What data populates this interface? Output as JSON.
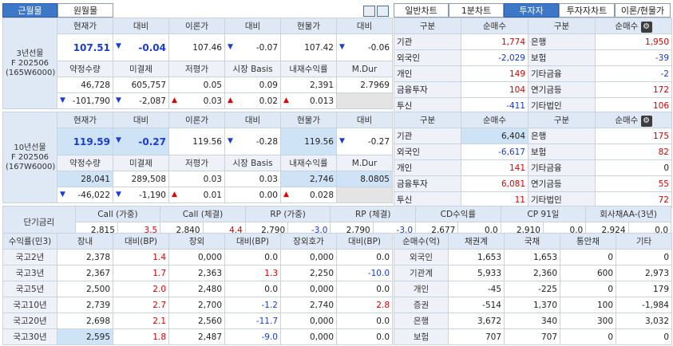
{
  "tabs_left": [
    {
      "label": "근월물",
      "active": true
    },
    {
      "label": "원월물",
      "active": false
    }
  ],
  "tabs_right": [
    {
      "label": "일반차트",
      "active": false
    },
    {
      "label": "1분차트",
      "active": false
    },
    {
      "label": "투자자",
      "active": true
    },
    {
      "label": "투자자차트",
      "active": false
    },
    {
      "label": "이론/현물가",
      "active": false
    }
  ],
  "futures": [
    {
      "name": "3년선물",
      "month": "F 202506",
      "code": "(165W6000)",
      "h1": [
        "현재가",
        "대비",
        "이론가",
        "대비",
        "현물가",
        "대비"
      ],
      "r1": {
        "price": "107.51",
        "chg_arrow": "▼",
        "chg": "-0.04",
        "theory": "107.46",
        "tchg_arrow": "▼",
        "tchg": "-0.07",
        "spot": "107.42",
        "schg_arrow": "▼",
        "schg": "-0.06"
      },
      "h2": [
        "약정수량",
        "미결제",
        "저평가",
        "시장 Basis",
        "내재수익률",
        "M.Dur"
      ],
      "r2": [
        "46,728",
        "605,757",
        "0.05",
        "0.09",
        "2,391",
        "2.7969"
      ],
      "r3": [
        {
          "a": "▼",
          "v": "-101,790"
        },
        {
          "a": "▼",
          "v": "-2,087"
        },
        {
          "a": "▲",
          "v": "0.03"
        },
        {
          "a": "▲",
          "v": "0.02"
        },
        {
          "a": "▲",
          "v": "0.013"
        },
        {
          "a": "",
          "v": ""
        }
      ]
    },
    {
      "name": "10년선물",
      "month": "F 202506",
      "code": "(167W6000)",
      "h1": [
        "현재가",
        "대비",
        "이론가",
        "대비",
        "현물가",
        "대비"
      ],
      "r1": {
        "price": "119.59",
        "chg_arrow": "▼",
        "chg": "-0.27",
        "theory": "119.56",
        "tchg_arrow": "▼",
        "tchg": "-0.28",
        "spot": "119.56",
        "schg_arrow": "▼",
        "schg": "-0.27"
      },
      "h2": [
        "약정수량",
        "미결제",
        "저평가",
        "시장 Basis",
        "내재수익률",
        "M.Dur"
      ],
      "r2": [
        "28,041",
        "289,508",
        "0.03",
        "0.03",
        "2,746",
        "8.0805"
      ],
      "r3": [
        {
          "a": "▼",
          "v": "-46,022"
        },
        {
          "a": "▼",
          "v": "-1,190"
        },
        {
          "a": "▲",
          "v": "0.01"
        },
        {
          "a": "",
          "v": "0.00"
        },
        {
          "a": "▲",
          "v": "0.028"
        },
        {
          "a": "",
          "v": ""
        }
      ]
    }
  ],
  "investors": [
    {
      "headers": [
        "구분",
        "순매수",
        "구분",
        "순매수"
      ],
      "rows": [
        [
          "기관",
          "1,774",
          "은행",
          "1,950"
        ],
        [
          "외국인",
          "-2,029",
          "보험",
          "-39"
        ],
        [
          "개인",
          "149",
          "기타금융",
          "-2"
        ],
        [
          "금융투자",
          "104",
          "연기금등",
          "172"
        ],
        [
          "투신",
          "-411",
          "기타법인",
          "106"
        ]
      ]
    },
    {
      "headers": [
        "구분",
        "순매수",
        "구분",
        "순매수"
      ],
      "rows": [
        [
          "기관",
          "6,404",
          "은행",
          "175"
        ],
        [
          "외국인",
          "-6,617",
          "보험",
          "82"
        ],
        [
          "개인",
          "141",
          "기타금융",
          "0"
        ],
        [
          "금융투자",
          "6,081",
          "연기금등",
          "55"
        ],
        [
          "투신",
          "11",
          "기타법인",
          "72"
        ]
      ]
    }
  ],
  "short_rate": {
    "label": "단기금리",
    "headers": [
      "Call (가중)",
      "Call (체결)",
      "RP (가중)",
      "RP (체결)",
      "CD수익률",
      "CP 91일",
      "회사채AA-(3년)"
    ],
    "values": [
      [
        "2,815",
        "3.5"
      ],
      [
        "2,840",
        "4.4"
      ],
      [
        "2,790",
        "-3.0"
      ],
      [
        "2,790",
        "-3.0"
      ],
      [
        "2,677",
        "0.0"
      ],
      [
        "2,910",
        "0.0"
      ],
      [
        "2,924",
        "0.0"
      ]
    ]
  },
  "yields": {
    "headers": [
      "수익률(민3)",
      "장내",
      "대비(BP)",
      "장외",
      "대비(BP)",
      "장외호가",
      "대비(BP)"
    ],
    "rows": [
      [
        "국고2년",
        "2,378",
        "1.4",
        "0,000",
        "0.0",
        "0,000",
        "0.0"
      ],
      [
        "국고3년",
        "2,367",
        "1.7",
        "2,363",
        "1.3",
        "2,250",
        "-10.0"
      ],
      [
        "국고5년",
        "2,500",
        "2.0",
        "2,480",
        "0.0",
        "0,000",
        "0.0"
      ],
      [
        "국고10년",
        "2,739",
        "2.7",
        "2,700",
        "-1.2",
        "2,740",
        "2.8"
      ],
      [
        "국고20년",
        "2,698",
        "2.1",
        "2,560",
        "-11.7",
        "0,000",
        "0.0"
      ],
      [
        "국고30년",
        "2,595",
        "1.8",
        "2,487",
        "-9.0",
        "0,000",
        "0.0"
      ]
    ]
  },
  "netbuy": {
    "headers": [
      "순매수(억)",
      "채권계",
      "국채",
      "통안채",
      "기타"
    ],
    "rows": [
      [
        "외국인",
        "1,653",
        "1,653",
        "0",
        "0"
      ],
      [
        "기관계",
        "5,933",
        "2,360",
        "600",
        "2,973"
      ],
      [
        "개인",
        "-45",
        "-225",
        "0",
        "179"
      ],
      [
        "증권",
        "-514",
        "1,370",
        "100",
        "-1,984"
      ],
      [
        "은행",
        "3,672",
        "340",
        "300",
        "3,032"
      ],
      [
        "보험",
        "707",
        "707",
        "0",
        "0"
      ]
    ]
  },
  "colors": {
    "accent": "#3d78c8",
    "header_bg": "#dfe8f5",
    "up": "#e00000",
    "down": "#1a3bd6"
  }
}
